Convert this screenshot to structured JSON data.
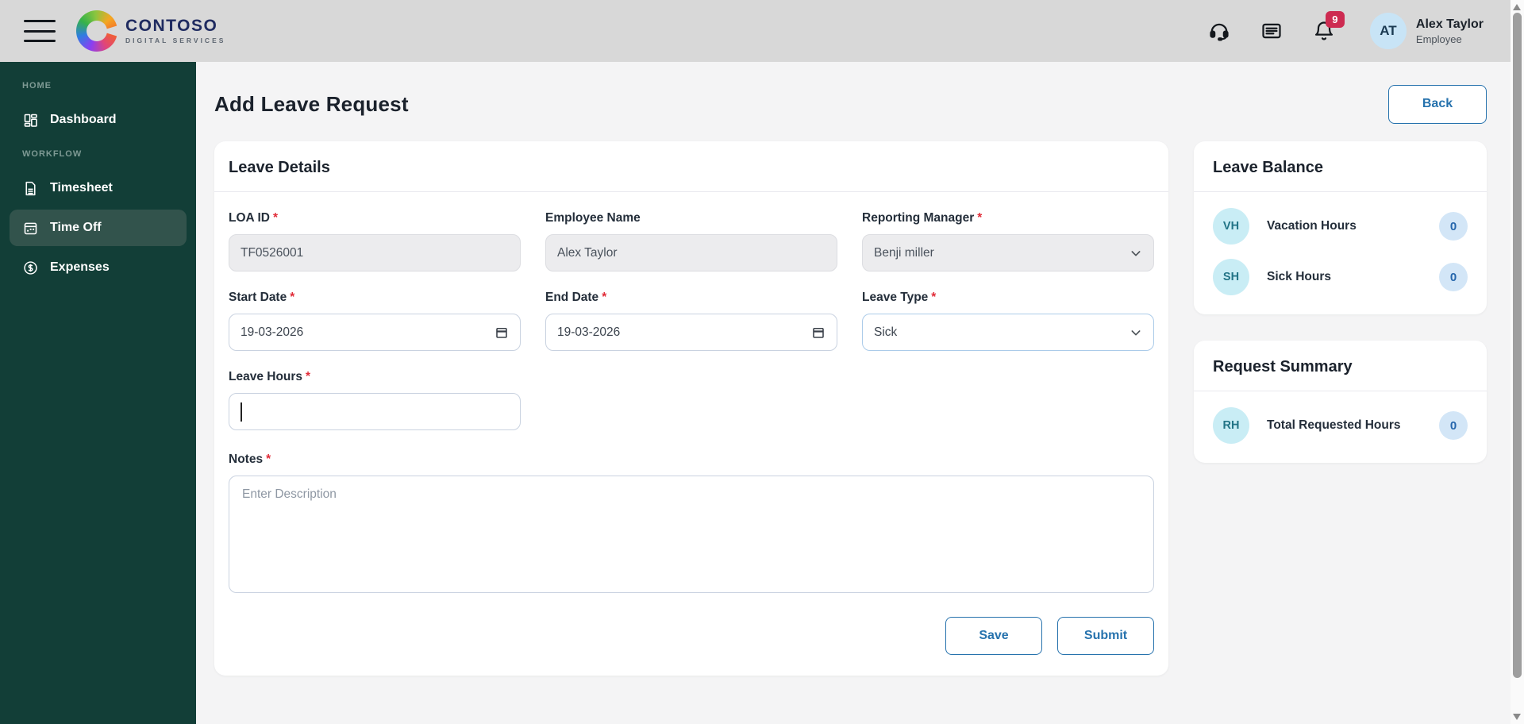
{
  "colors": {
    "accent_blue": "#2672AD",
    "sidebar_teal": "#123E37",
    "header_grey": "#D8D8D8",
    "badge_red": "#CD2B51",
    "avatar_blue": "#C8E4F6",
    "balance_circle_cyan": "#C9EDF5",
    "count_badge_blue": "#D3E6F7",
    "required_red": "#E12D39"
  },
  "icons": {
    "menu": "hamburger-icon",
    "support": "headset-icon",
    "news": "newsfeed-icon",
    "notifications": "bell-icon",
    "dashboard": "dashboard-grid-icon",
    "timesheet": "timesheet-document-icon",
    "time_off": "time-off-calendar-icon",
    "expenses": "expenses-dollar-icon",
    "select_chevron": "chevron-down-icon",
    "date_picker": "calendar-icon"
  },
  "header": {
    "brand": {
      "name": "CONTOSO",
      "tagline": "DIGITAL SERVICES"
    },
    "notifications": {
      "count": "9"
    },
    "user": {
      "initials": "AT",
      "name": "Alex Taylor",
      "role": "Employee"
    }
  },
  "sidebar": {
    "sections": [
      {
        "label": "HOME",
        "items": [
          {
            "label": "Dashboard",
            "active": false
          }
        ]
      },
      {
        "label": "WORKFLOW",
        "items": [
          {
            "label": "Timesheet",
            "active": false
          },
          {
            "label": "Time Off",
            "active": true
          },
          {
            "label": "Expenses",
            "active": false
          }
        ]
      }
    ]
  },
  "page": {
    "title": "Add Leave Request",
    "back_button": "Back"
  },
  "form": {
    "section_title": "Leave Details",
    "required_marker": "*",
    "fields": {
      "loa_id": {
        "label": "LOA ID",
        "required": true,
        "value": "TF0526001",
        "disabled": true
      },
      "employee_name": {
        "label": "Employee Name",
        "required": false,
        "value": "Alex Taylor",
        "disabled": true
      },
      "reporting_manager": {
        "label": "Reporting Manager",
        "required": true,
        "value": "Benji miller",
        "disabled": true,
        "type": "select"
      },
      "start_date": {
        "label": "Start Date",
        "required": true,
        "value": "19-03-2026",
        "type": "date"
      },
      "end_date": {
        "label": "End Date",
        "required": true,
        "value": "19-03-2026",
        "type": "date"
      },
      "leave_type": {
        "label": "Leave Type",
        "required": true,
        "value": "Sick",
        "type": "select"
      },
      "leave_hours": {
        "label": "Leave Hours",
        "required": true,
        "value": "",
        "focused": true
      },
      "notes": {
        "label": "Notes",
        "required": true,
        "value": "",
        "placeholder": "Enter Description",
        "type": "textarea"
      }
    },
    "actions": {
      "save": "Save",
      "submit": "Submit"
    }
  },
  "leave_balance": {
    "title": "Leave Balance",
    "items": [
      {
        "initials": "VH",
        "label": "Vacation Hours",
        "value": "0"
      },
      {
        "initials": "SH",
        "label": "Sick Hours",
        "value": "0"
      }
    ]
  },
  "request_summary": {
    "title": "Request Summary",
    "items": [
      {
        "initials": "RH",
        "label": "Total Requested Hours",
        "value": "0"
      }
    ]
  }
}
